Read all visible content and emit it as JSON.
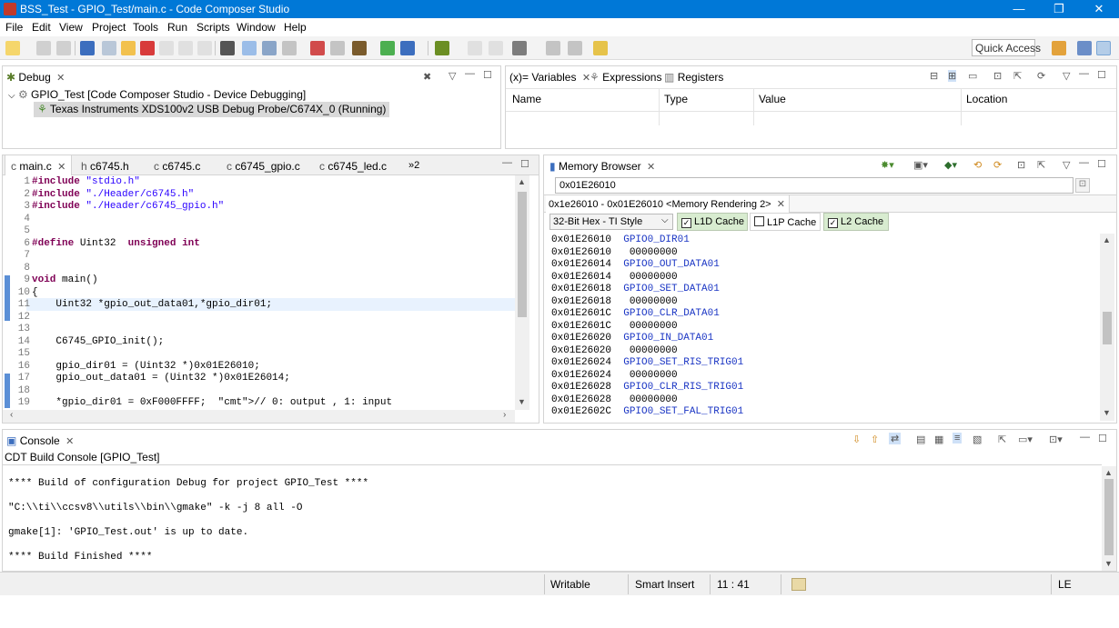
{
  "window": {
    "title": "BSS_Test - GPIO_Test/main.c - Code Composer Studio",
    "minimize": "—",
    "maximize": "❐",
    "close": "✕"
  },
  "menu": [
    "File",
    "Edit",
    "View",
    "Project",
    "Tools",
    "Run",
    "Scripts",
    "Window",
    "Help"
  ],
  "toolbar": {
    "quick_access": "Quick Access"
  },
  "debug_view": {
    "tab_label": "Debug",
    "tree": [
      {
        "label": "GPIO_Test [Code Composer Studio - Device Debugging]"
      },
      {
        "label": "Texas Instruments XDS100v2 USB Debug Probe/C674X_0 (Running)"
      }
    ]
  },
  "variables_view": {
    "tabs": [
      "(x)= Variables",
      "Expressions",
      "Registers"
    ],
    "columns": [
      "Name",
      "Type",
      "Value",
      "Location"
    ]
  },
  "editor": {
    "tabs": [
      "main.c",
      "c6745.h",
      "c6745.c",
      "c6745_gpio.c",
      "c6745_led.c"
    ],
    "overflow": "»2",
    "lines": [
      {
        "n": "1",
        "text": "#include \"stdio.h\""
      },
      {
        "n": "2",
        "text": "#include \"./Header/c6745.h\""
      },
      {
        "n": "3",
        "text": "#include \"./Header/c6745_gpio.h\""
      },
      {
        "n": "4",
        "text": ""
      },
      {
        "n": "5",
        "text": ""
      },
      {
        "n": "6",
        "text": "#define Uint32  unsigned int"
      },
      {
        "n": "7",
        "text": ""
      },
      {
        "n": "8",
        "text": ""
      },
      {
        "n": "9",
        "text": "void main()"
      },
      {
        "n": "10",
        "text": "{"
      },
      {
        "n": "11",
        "text": "    Uint32 *gpio_out_data01,*gpio_dir01;"
      },
      {
        "n": "12",
        "text": ""
      },
      {
        "n": "13",
        "text": ""
      },
      {
        "n": "14",
        "text": "    C6745_GPIO_init();"
      },
      {
        "n": "15",
        "text": ""
      },
      {
        "n": "16",
        "text": "    gpio_dir01 = (Uint32 *)0x01E26010;"
      },
      {
        "n": "17",
        "text": "    gpio_out_data01 = (Uint32 *)0x01E26014;"
      },
      {
        "n": "18",
        "text": ""
      },
      {
        "n": "19",
        "text": "    *gpio_dir01 = 0xF000FFFF;  // 0: output , 1: input"
      }
    ]
  },
  "memory_browser": {
    "tab_label": "Memory Browser",
    "address_input": "0x01E26010",
    "rendering_tab": "0x1e26010 - 0x01E26010 <Memory Rendering 2>",
    "format_select": "32-Bit Hex - TI Style",
    "caches": [
      {
        "label": "L1D Cache",
        "checked": "✓"
      },
      {
        "label": "L1P Cache",
        "checked": ""
      },
      {
        "label": "L2 Cache",
        "checked": "✓"
      }
    ],
    "rows": [
      {
        "addr": "0x01E26010",
        "val": "GPIO0_DIR01",
        "sym": true
      },
      {
        "addr": "0x01E26010",
        "val": " 00000000",
        "sym": false
      },
      {
        "addr": "0x01E26014",
        "val": "GPIO0_OUT_DATA01",
        "sym": true
      },
      {
        "addr": "0x01E26014",
        "val": " 00000000",
        "sym": false
      },
      {
        "addr": "0x01E26018",
        "val": "GPIO0_SET_DATA01",
        "sym": true
      },
      {
        "addr": "0x01E26018",
        "val": " 00000000",
        "sym": false
      },
      {
        "addr": "0x01E2601C",
        "val": "GPIO0_CLR_DATA01",
        "sym": true
      },
      {
        "addr": "0x01E2601C",
        "val": " 00000000",
        "sym": false
      },
      {
        "addr": "0x01E26020",
        "val": "GPIO0_IN_DATA01",
        "sym": true
      },
      {
        "addr": "0x01E26020",
        "val": " 00000000",
        "sym": false
      },
      {
        "addr": "0x01E26024",
        "val": "GPIO0_SET_RIS_TRIG01",
        "sym": true
      },
      {
        "addr": "0x01E26024",
        "val": " 00000000",
        "sym": false
      },
      {
        "addr": "0x01E26028",
        "val": "GPIO0_CLR_RIS_TRIG01",
        "sym": true
      },
      {
        "addr": "0x01E26028",
        "val": " 00000000",
        "sym": false
      },
      {
        "addr": "0x01E2602C",
        "val": "GPIO0_SET_FAL_TRIG01",
        "sym": true
      }
    ]
  },
  "console": {
    "tab_label": "Console",
    "subtitle": "CDT Build Console [GPIO_Test]",
    "lines": [
      "**** Build of configuration Debug for project GPIO_Test ****",
      "\"C:\\\\ti\\\\ccsv8\\\\utils\\\\bin\\\\gmake\" -k -j 8 all -O",
      "gmake[1]: 'GPIO_Test.out' is up to date.",
      "**** Build Finished ****"
    ]
  },
  "status": {
    "writable": "Writable",
    "insert_mode": "Smart Insert",
    "position": "11 : 41",
    "line_ending": "LE"
  },
  "colors": {
    "titlebar": "#0078d7",
    "keyword": "#7f0055",
    "string": "#2a00ff",
    "comment": "#3f7f5f",
    "symbol": "#1a35c4"
  }
}
